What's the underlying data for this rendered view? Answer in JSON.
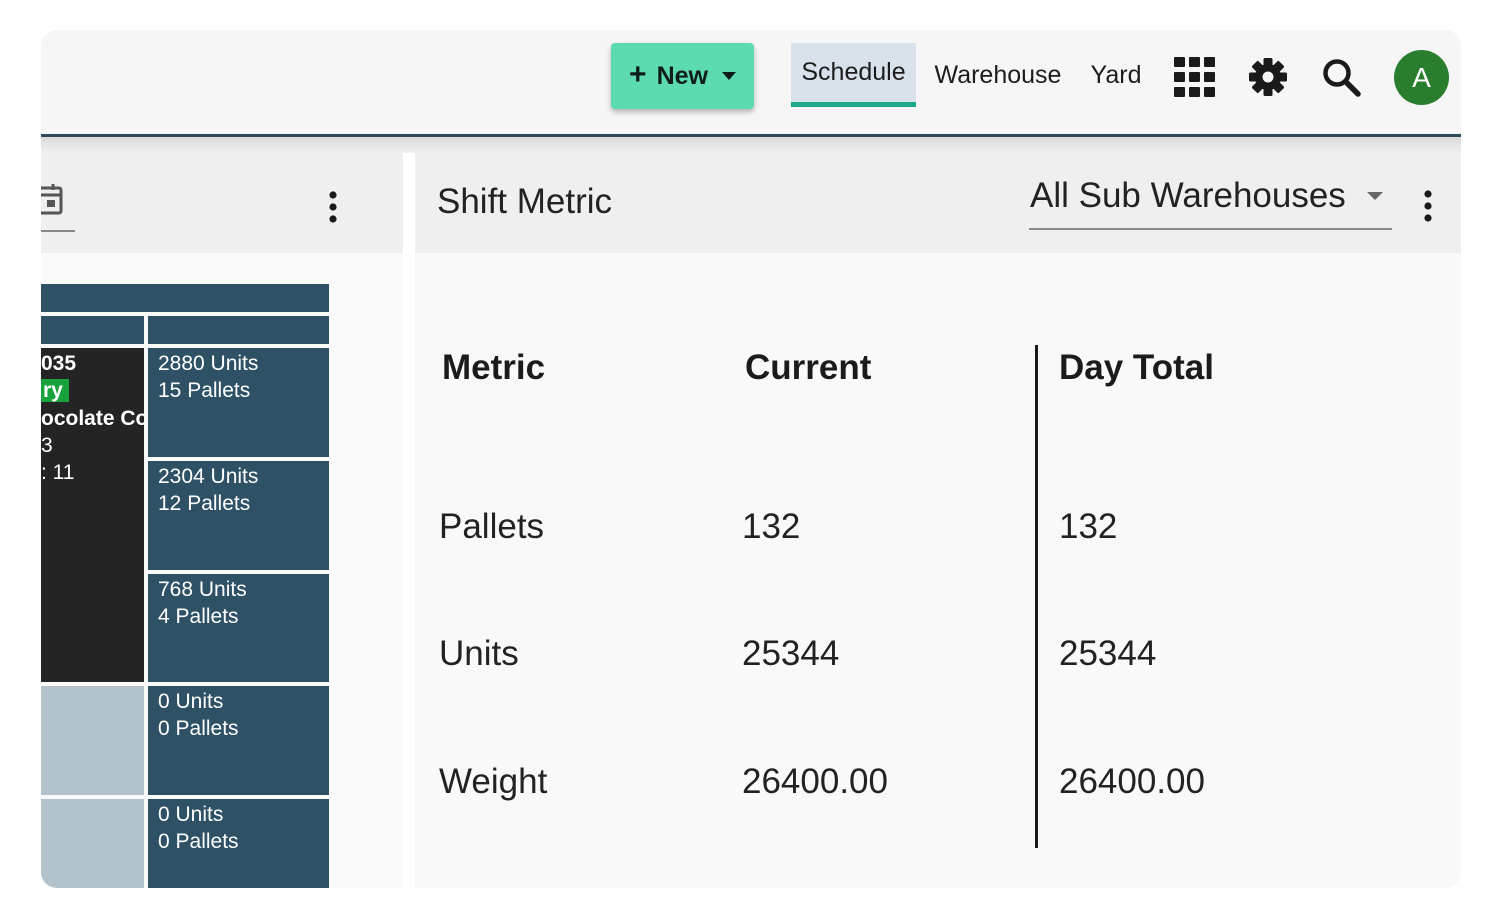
{
  "header": {
    "new_button": {
      "label": "New",
      "plus": "+"
    },
    "tabs": [
      {
        "label": "Schedule",
        "active": true
      },
      {
        "label": "Warehouse",
        "active": false
      },
      {
        "label": "Yard",
        "active": false
      }
    ],
    "icons": [
      "apps-grid-icon",
      "gear-icon",
      "search-icon"
    ],
    "avatar_initial": "A"
  },
  "left_panel": {
    "booking_card": {
      "line1": "035",
      "tag": "ry",
      "line3": "ocolate Co",
      "line4": "3",
      "line5": ": 11"
    },
    "cells": [
      {
        "units": "2880 Units",
        "pallets": "15 Pallets"
      },
      {
        "units": "2304 Units",
        "pallets": "12 Pallets"
      },
      {
        "units": "768 Units",
        "pallets": "4 Pallets"
      },
      {
        "units": "0 Units",
        "pallets": "0 Pallets"
      },
      {
        "units": "0 Units",
        "pallets": "0 Pallets"
      }
    ]
  },
  "shift_metric": {
    "title": "Shift Metric",
    "sub_warehouse": "All Sub Warehouses",
    "columns": [
      "Metric",
      "Current",
      "Day Total"
    ],
    "rows": [
      {
        "metric": "Pallets",
        "current": "132",
        "day_total": "132"
      },
      {
        "metric": "Units",
        "current": "25344",
        "day_total": "25344"
      },
      {
        "metric": "Weight",
        "current": "26400.00",
        "day_total": "26400.00"
      }
    ]
  },
  "colors": {
    "accent_green": "#5ddbb0",
    "active_tab_underline": "#1ea98a",
    "cell_blue": "#2e5165",
    "avatar_green": "#2b7d2e",
    "tag_green": "#18a23b"
  }
}
